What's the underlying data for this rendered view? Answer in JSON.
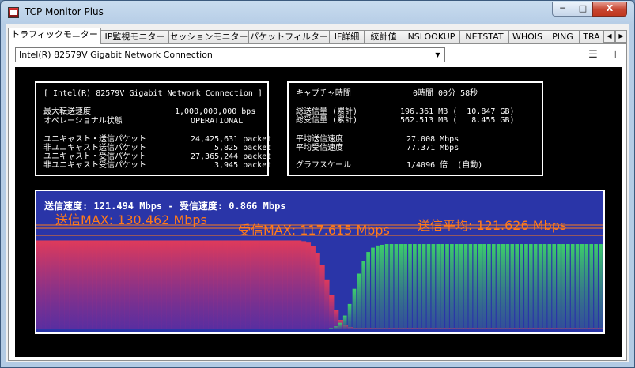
{
  "window": {
    "title": "TCP Monitor Plus",
    "min_label": "─",
    "max_label": "□",
    "close_label": "X"
  },
  "tabs": [
    {
      "label": "トラフィックモニター",
      "active": true
    },
    {
      "label": "IP監視モニター"
    },
    {
      "label": "セッションモニター"
    },
    {
      "label": "パケットフィルター"
    },
    {
      "label": "IF詳細"
    },
    {
      "label": "統計値"
    },
    {
      "label": "NSLOOKUP"
    },
    {
      "label": "NETSTAT"
    },
    {
      "label": "WHOIS"
    },
    {
      "label": "PING"
    },
    {
      "label": "TRA"
    }
  ],
  "tab_scroll": {
    "left": "◀",
    "right": "▶"
  },
  "adapter_select": {
    "value": "Intel(R) 82579V Gigabit Network Connection",
    "arrow": "▼"
  },
  "toolbar": {
    "menu_icon": "☰",
    "pin_icon": "⊣"
  },
  "left_panel": {
    "header": "[ Intel(R) 82579V Gigabit Network Connection ]",
    "rows": [
      {
        "label": "最大転送速度",
        "value": "1,000,000,000 bps"
      },
      {
        "label": "オペレーショナル状態",
        "value": "OPERATIONAL"
      },
      {
        "label": "ユニキャスト・送信パケット",
        "value": "24,425,631 packet"
      },
      {
        "label": "非ユニキャスト送信パケット",
        "value": "5,825 packet"
      },
      {
        "label": "ユニキャスト・受信パケット",
        "value": "27,365,244 packet"
      },
      {
        "label": "非ユニキャスト受信パケット",
        "value": "3,945 packet"
      }
    ]
  },
  "right_panel": {
    "rows": [
      {
        "label": "キャプチャ時間",
        "value": "0時間 00分 58秒"
      },
      {
        "label": "総送信量 (累計)",
        "value": "196.361 MB (  10.847 GB)"
      },
      {
        "label": "総受信量 (累計)",
        "value": "562.513 MB (   8.455 GB)"
      },
      {
        "label": "平均送信速度",
        "value": "27.008 Mbps"
      },
      {
        "label": "平均受信速度",
        "value": "77.371 Mbps"
      },
      {
        "label": "グラフスケール",
        "value": "1/4096 倍  (自動)"
      }
    ]
  },
  "graph": {
    "speed_line": "送信速度: 121.494 Mbps  -  受信速度:   0.866 Mbps",
    "send_max": "送信MAX: 130.462 Mbps",
    "recv_max": "受信MAX: 117.615 Mbps",
    "send_avg": "送信平均: 121.626 Mbps",
    "colors": {
      "background": "#2a35a8",
      "send": "#e03a5a",
      "recv": "#3ccf6a",
      "label": "#ff7a1a",
      "text": "#ffffff"
    },
    "send_series": [
      122,
      122,
      122,
      122,
      122,
      122,
      122,
      122,
      122,
      122,
      122,
      122,
      122,
      122,
      122,
      122,
      122,
      122,
      122,
      122,
      122,
      122,
      122,
      122,
      122,
      122,
      122,
      122,
      122,
      122,
      122,
      122,
      122,
      122,
      122,
      122,
      122,
      122,
      122,
      122,
      122,
      122,
      122,
      122,
      122,
      122,
      122,
      122,
      122,
      122,
      122,
      122,
      122,
      122,
      122,
      122,
      122,
      121,
      119,
      114,
      104,
      88,
      68,
      46,
      26,
      12,
      5,
      2,
      1,
      1,
      1,
      1,
      1,
      1,
      1,
      1,
      1,
      1,
      1,
      1,
      1,
      1,
      1,
      1,
      1,
      1,
      1,
      1,
      1,
      1,
      1,
      1,
      1,
      1,
      1,
      1,
      1,
      1,
      1,
      1,
      1,
      1,
      1,
      1,
      1,
      1,
      1,
      1,
      1,
      1,
      1,
      1,
      1,
      1,
      1,
      1,
      1,
      1,
      1,
      1,
      1,
      1
    ],
    "recv_series": [
      0,
      0,
      0,
      0,
      0,
      0,
      0,
      0,
      0,
      0,
      0,
      0,
      0,
      0,
      0,
      0,
      0,
      0,
      0,
      0,
      0,
      0,
      0,
      0,
      0,
      0,
      0,
      0,
      0,
      0,
      0,
      0,
      0,
      0,
      0,
      0,
      0,
      0,
      0,
      0,
      0,
      0,
      0,
      0,
      0,
      0,
      0,
      0,
      0,
      0,
      0,
      0,
      0,
      0,
      0,
      0,
      0,
      0,
      0,
      0,
      0,
      0,
      0,
      1,
      3,
      8,
      18,
      34,
      55,
      76,
      94,
      106,
      112,
      115,
      116,
      117,
      117,
      117,
      117,
      117,
      117,
      117,
      117,
      117,
      117,
      117,
      117,
      117,
      117,
      117,
      117,
      117,
      117,
      117,
      117,
      117,
      117,
      117,
      117,
      117,
      117,
      117,
      117,
      117,
      117,
      117,
      117,
      117,
      117,
      117,
      117,
      117,
      117,
      117,
      117,
      117,
      117,
      117,
      117,
      117,
      117,
      117
    ],
    "scale_max": 140
  }
}
